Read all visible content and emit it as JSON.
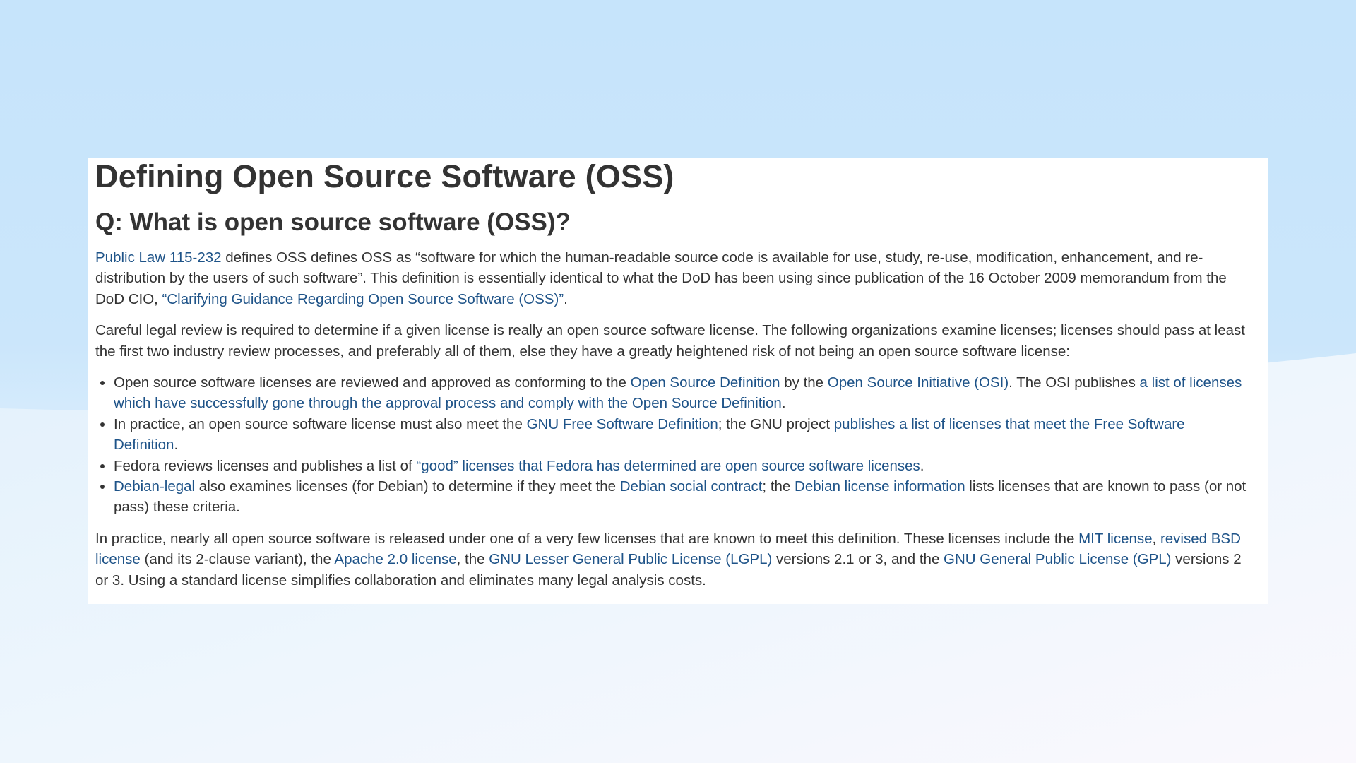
{
  "page": {
    "title": "Defining Open Source Software (OSS)",
    "question": "Q: What is open source software (OSS)?"
  },
  "intro": {
    "link_public_law": "Public Law 115-232",
    "text1": " defines OSS defines OSS as “software for which the human-readable source code is available for use, study, re-use, modification, enhancement, and re-distribution by the users of such software”. This definition is essentially identical to what the DoD has been using since publication of the 16 October 2009 memorandum from the DoD CIO, ",
    "link_guidance": "“Clarifying Guidance Regarding Open Source Software (OSS)”",
    "text2": "."
  },
  "review": {
    "text": "Careful legal review is required to determine if a given license is really an open source software license. The following organizations examine licenses; licenses should pass at least the first two industry review processes, and preferably all of them, else they have a greatly heightened risk of not being an open source software license:"
  },
  "bullets": {
    "osi": {
      "text1": "Open source software licenses are reviewed and approved as conforming to the ",
      "link_osd": "Open Source Definition",
      "text2": " by the ",
      "link_osi": "Open Source Initiative (OSI)",
      "text3": ". The OSI publishes ",
      "link_list": "a list of licenses which have successfully gone through the approval process and comply with the Open Source Definition",
      "text4": "."
    },
    "gnu": {
      "text1": "In practice, an open source software license must also meet the ",
      "link_fsd": "GNU Free Software Definition",
      "text2": "; the GNU project ",
      "link_list": "publishes a list of licenses that meet the Free Software Definition",
      "text3": "."
    },
    "fedora": {
      "text1": "Fedora reviews licenses and publishes a list of ",
      "link_good": "“good” licenses that Fedora has determined are open source software licenses",
      "text2": "."
    },
    "debian": {
      "link_legal": "Debian-legal",
      "text1": " also examines licenses (for Debian) to determine if they meet the ",
      "link_contract": "Debian social contract",
      "text2": "; the ",
      "link_info": "Debian license information",
      "text3": " lists licenses that are known to pass (or not pass) these criteria."
    }
  },
  "practice": {
    "text1": "In practice, nearly all open source software is released under one of a very few licenses that are known to meet this definition. These licenses include the ",
    "link_mit": "MIT license",
    "text2": ", ",
    "link_bsd": "revised BSD license",
    "text3": " (and its 2-clause variant), the ",
    "link_apache": "Apache 2.0 license",
    "text4": ", the ",
    "link_lgpl": "GNU Lesser General Public License (LGPL)",
    "text5": " versions 2.1 or 3, and the ",
    "link_gpl": "GNU General Public License (GPL)",
    "text6": " versions 2 or 3. Using a standard license simplifies collaboration and eliminates many legal analysis costs."
  },
  "colors": {
    "link": "#1e5388",
    "text": "#333333",
    "background_top": "#c6e4fb",
    "background_bottom": "#f8f7fd",
    "card": "#ffffff"
  }
}
